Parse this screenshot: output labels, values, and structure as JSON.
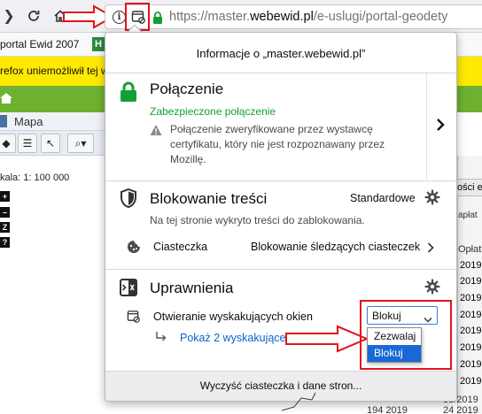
{
  "url": {
    "prefix": "https://master.",
    "domain": "webewid.pl",
    "path": "/e-uslugi/portal-geodety"
  },
  "bookmarks": {
    "item1": "portal Ewid 2007",
    "item1_mark": "H"
  },
  "notification": {
    "text": "refox uniemożliwił tej w"
  },
  "app": {
    "map_tab": "Mapa",
    "scale_label": "kala:",
    "scale_value": "1: 100 000",
    "map_buttons": [
      "+",
      "–",
      "Z",
      "?"
    ]
  },
  "right_bg": {
    "tab_fragment": "ości e",
    "col_fragment1": "apłat",
    "col_header": "Opłat",
    "years": [
      "2019",
      "2019",
      "2019",
      "2019",
      "2019",
      "2019",
      "2019",
      "2019"
    ],
    "bottom_rows": [
      "33/2019",
      "194 2019",
      "24 2019"
    ]
  },
  "popup": {
    "title": "Informacje o „master.webewid.pl”",
    "connection": {
      "heading": "Połączenie",
      "status": "Zabezpieczone połączenie",
      "note": [
        "Połączenie zweryfikowane przez wystawcę",
        "certyfikatu, który nie jest rozpoznawany przez",
        "Mozillę."
      ]
    },
    "content_blocking": {
      "heading": "Blokowanie treści",
      "mode": "Standardowe",
      "desc": "Na tej stronie wykryto treści do zablokowania.",
      "cookies_label": "Ciasteczka",
      "cookies_value": "Blokowanie śledzących ciasteczek"
    },
    "permissions": {
      "heading": "Uprawnienia",
      "popup_label": "Otwieranie wyskakujących okien",
      "show_popups": "Pokaż 2 wyskakujące okna...",
      "selected": "Blokuj",
      "options": [
        "Zezwalaj",
        "Blokuj"
      ]
    },
    "footer": "Wyczyść ciasteczka i dane stron..."
  },
  "colors": {
    "green_secure": "#12a033",
    "link_blue": "#0a63cf",
    "select_highlight": "#1a68d6",
    "annotation_red": "#e0141e",
    "notification_yellow": "#ffe900",
    "app_green": "#6eb130"
  }
}
